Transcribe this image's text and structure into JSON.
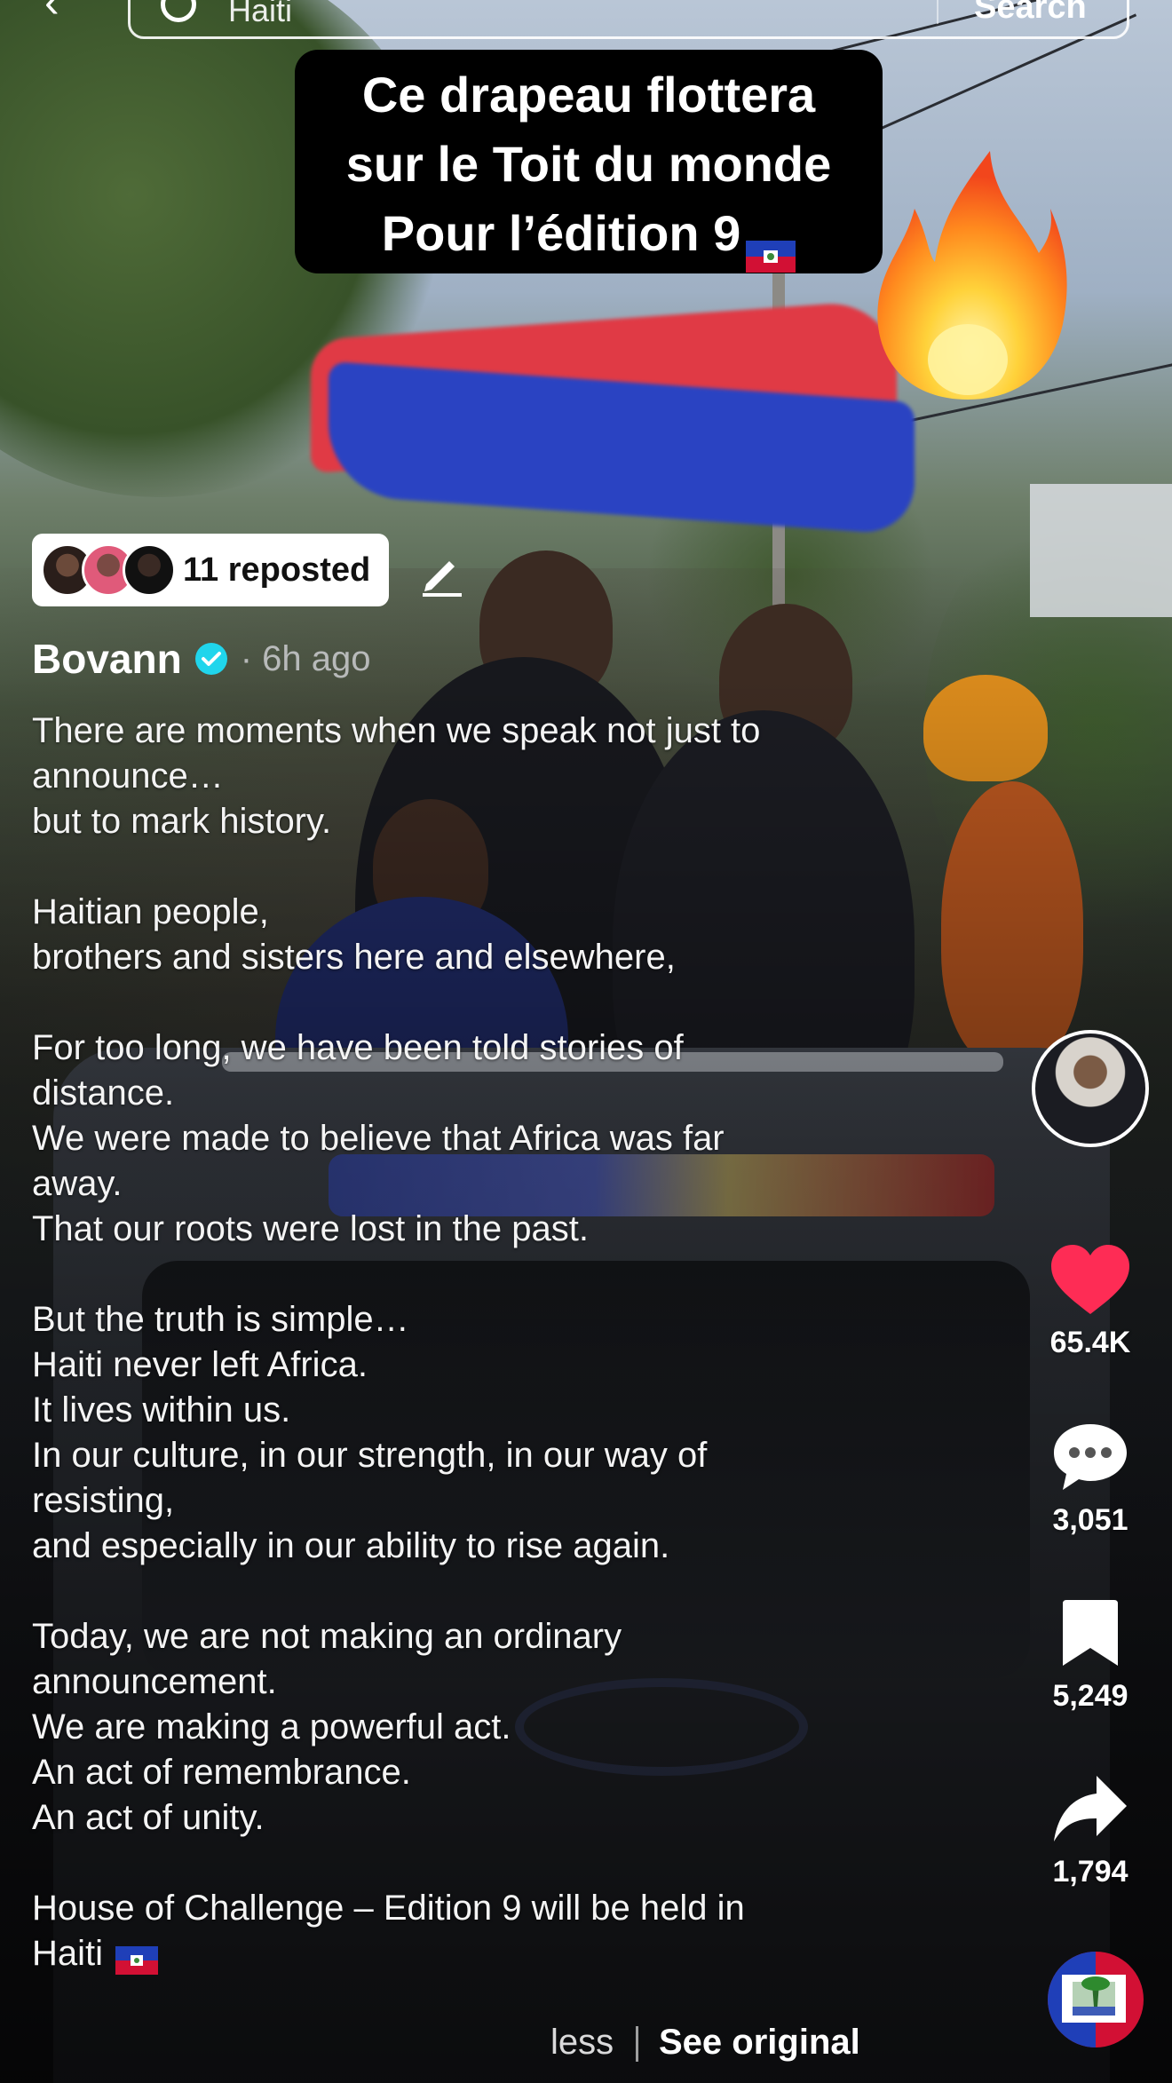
{
  "search": {
    "query": "Haiti",
    "button_label": "Search"
  },
  "caption_sticker": {
    "lines": [
      "Ce drapeau flottera",
      "sur le Toit du monde",
      "Pour l’édition 9"
    ]
  },
  "repost": {
    "label": "11 reposted"
  },
  "author": {
    "name": "Bovann",
    "time": "· 6h ago"
  },
  "description": {
    "lines": [
      "There are moments when we speak not just to",
      "announce…",
      "but to mark history.",
      "",
      "Haitian people,",
      "brothers and sisters here and elsewhere,",
      "",
      "For too long, we have been told stories of",
      "distance.",
      "We were made to believe that Africa was far",
      "away.",
      "That our roots were lost in the past.",
      "",
      "But the truth is simple…",
      "Haiti never left Africa.",
      "It lives within us.",
      "In our culture, in our strength, in our way of",
      "resisting,",
      "and especially in our ability to rise again.",
      "",
      "Today, we are not making an ordinary",
      "announcement.",
      "We are making a powerful act.",
      "An act of remembrance.",
      "An act of unity.",
      "",
      "House of Challenge – Edition 9 will be held in",
      "Haiti"
    ]
  },
  "toggles": {
    "less": "less",
    "see_original": "See original"
  },
  "actions": {
    "likes": "65.4K",
    "comments": "3,051",
    "saves": "5,249",
    "shares": "1,794"
  },
  "colors": {
    "like": "#fe2c55",
    "verified": "#20d5ec",
    "haiti_blue": "#1f3fb8",
    "haiti_red": "#d21034"
  },
  "icons": [
    "back-arrow-icon",
    "search-icon",
    "fire-emoji-icon",
    "haiti-flag-icon",
    "edit-pencil-icon",
    "verified-badge-icon",
    "heart-icon",
    "comment-icon",
    "bookmark-icon",
    "share-icon"
  ]
}
